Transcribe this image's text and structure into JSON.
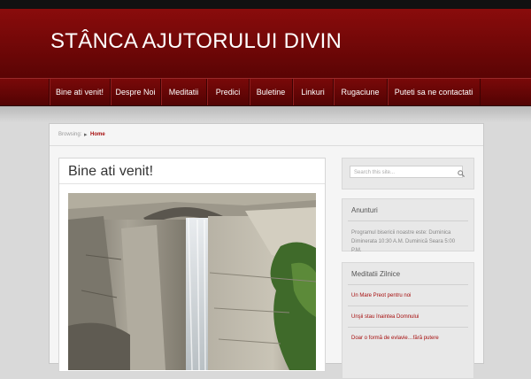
{
  "site": {
    "title": "STÂNCA AJUTORULUI DIVIN"
  },
  "nav": {
    "items": [
      {
        "label": "Bine ati venit!"
      },
      {
        "label": "Despre Noi"
      },
      {
        "label": "Meditatii"
      },
      {
        "label": "Predici"
      },
      {
        "label": "Buletine"
      },
      {
        "label": "Linkuri"
      },
      {
        "label": "Rugaciune"
      },
      {
        "label": "Puteti sa ne contactati"
      }
    ]
  },
  "breadcrumb": {
    "browsing": "Browsing:",
    "home": "Home"
  },
  "post": {
    "title": "Bine ati venit!"
  },
  "search": {
    "placeholder": "Search this site..."
  },
  "widgets": {
    "anunturi": {
      "title": "Anunturi",
      "text": "Programul bisericii noastre este: Duminica Diminerata 10:30 A.M. Duminică Seara 5:00 P.M."
    },
    "meditatii": {
      "title": "Meditatii Zilnice",
      "links": [
        {
          "label": "Un Mare Preot pentru noi"
        },
        {
          "label": "Unşii stau înaintea Domnului"
        },
        {
          "label": "Doar o formă de evlavie…fără putere"
        }
      ]
    }
  },
  "colors": {
    "brand_red": "#7a0909",
    "link_red": "#a60e0e"
  }
}
